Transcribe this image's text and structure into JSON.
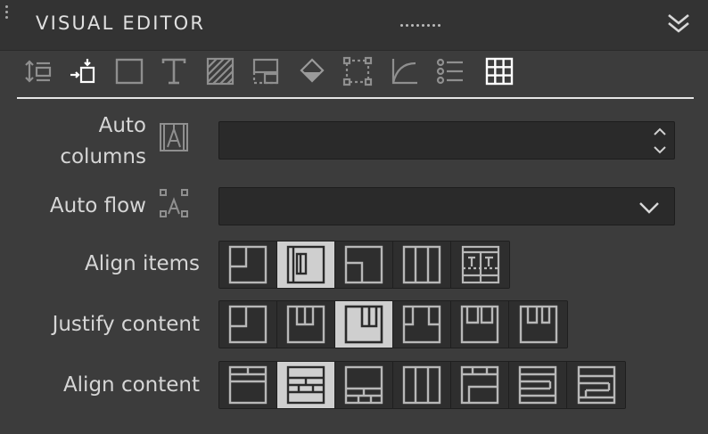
{
  "panel": {
    "title": "VISUAL EDITOR",
    "collapse_icon": "double-chevron-down-icon"
  },
  "toolbar": {
    "icons": [
      "vertical-spacing-icon",
      "position-icon",
      "box-icon",
      "text-icon",
      "background-hatch-icon",
      "layout-icon",
      "fill-diamond-icon",
      "border-icon",
      "curve-icon",
      "list-icon",
      "grid-icon"
    ],
    "active": "grid-icon"
  },
  "props": {
    "auto_columns": {
      "label_line1": "Auto",
      "label_line2": "columns",
      "value": ""
    },
    "auto_flow": {
      "label": "Auto flow",
      "value": ""
    },
    "align_items": {
      "label": "Align items",
      "options": 5,
      "selected": 1
    },
    "justify_content": {
      "label": "Justify content",
      "options": 6,
      "selected": 2
    },
    "align_content": {
      "label": "Align content",
      "options": 7,
      "selected": 1
    }
  },
  "colors": {
    "panel_bg": "#3c3c3c",
    "header_bg": "#333333",
    "field_bg": "#2a2a2a",
    "active_btn": "#cfcfcf",
    "icon": "#b8b8b8"
  }
}
